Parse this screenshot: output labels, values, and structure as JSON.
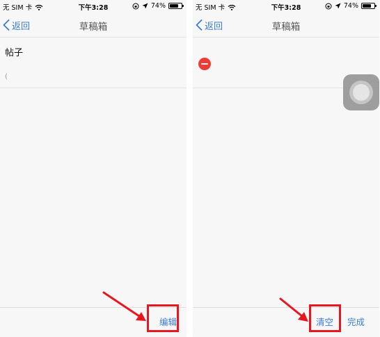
{
  "status_bar": {
    "carrier": "无 SIM 卡",
    "time": "下午3:28",
    "battery_text": "74%",
    "battery_level": 0.74
  },
  "nav": {
    "back_label": "返回",
    "title": "草稿箱"
  },
  "draft": {
    "title": "帖子",
    "snippet": "("
  },
  "toolbar": {
    "edit_label": "编辑",
    "clear_label": "清空",
    "done_label": "完成"
  },
  "colors": {
    "accent": "#3a7ccf",
    "delete_red": "#ef3b36",
    "annotation_red": "#e8161e"
  }
}
